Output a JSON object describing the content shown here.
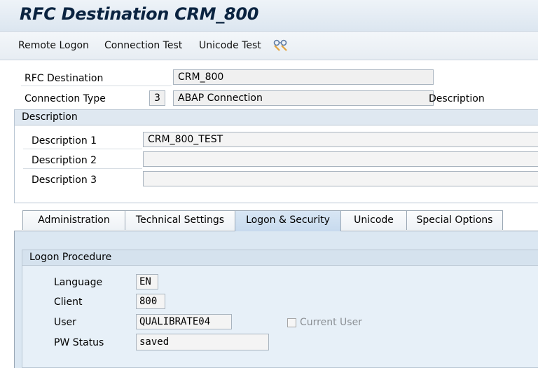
{
  "window": {
    "title": "RFC Destination CRM_800"
  },
  "toolbar": {
    "items": [
      "Remote Logon",
      "Connection Test",
      "Unicode Test"
    ],
    "icon": "glasses-icon"
  },
  "header": {
    "rfc_destination_label": "RFC Destination",
    "rfc_destination_value": "CRM_800",
    "connection_type_label": "Connection Type",
    "connection_type_code": "3",
    "connection_type_value": "ABAP Connection",
    "description_label": "Description"
  },
  "description_group": {
    "title": "Description",
    "rows": [
      {
        "label": "Description 1",
        "value": "CRM_800_TEST"
      },
      {
        "label": "Description 2",
        "value": ""
      },
      {
        "label": "Description 3",
        "value": ""
      }
    ]
  },
  "tabs": {
    "labels": [
      "Administration",
      "Technical Settings",
      "Logon & Security",
      "Unicode",
      "Special Options"
    ],
    "active": "Logon & Security"
  },
  "logon_procedure": {
    "title": "Logon Procedure",
    "language_label": "Language",
    "language_value": "EN",
    "client_label": "Client",
    "client_value": "800",
    "user_label": "User",
    "user_value": "QUALIBRATE04",
    "current_user_label": "Current User",
    "current_user_checked": false,
    "pw_status_label": "PW Status",
    "pw_status_value": "saved"
  },
  "colors": {
    "title_text": "#0a2340",
    "group_header": "#dfe8f1",
    "tab_panel": "#dbe7f2",
    "active_tab": "#c7daee"
  }
}
